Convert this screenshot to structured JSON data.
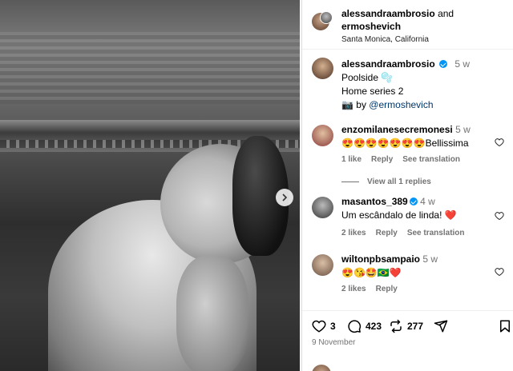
{
  "header": {
    "user1": "alessandraambrosio",
    "and_text": "and",
    "user2": "ermoshevich",
    "location": "Santa Monica, California"
  },
  "caption": {
    "username": "alessandraambrosio",
    "time": "5 w",
    "line1": "Poolside 🫧",
    "line2": "Home series 2",
    "photo_prefix": "📷 by ",
    "photo_credit": "@ermoshevich"
  },
  "comments": [
    {
      "username": "enzomilanesecremonesi",
      "time": "5 w",
      "text": "😍😍😍😍😍😍😍Bellissima",
      "likes": "1 like",
      "reply": "Reply",
      "translate": "See translation",
      "verified": false
    },
    {
      "username": "masantos_389",
      "time": "4 w",
      "text": "Um escândalo de linda! ❤️",
      "likes": "2 likes",
      "reply": "Reply",
      "translate": "See translation",
      "verified": true
    },
    {
      "username": "wiltonpbsampaio",
      "time": "5 w",
      "text": "😍😘🤩🇧🇷❤️",
      "likes": "2 likes",
      "reply": "Reply",
      "translate": "",
      "verified": false
    }
  ],
  "view_replies": "View all 1 replies",
  "actions": {
    "likes_count": "3",
    "comments_count": "423",
    "reposts_count": "277"
  },
  "date": "9 November",
  "colors": {
    "verified": "#0095f6",
    "link": "#00376b",
    "muted": "#737373"
  }
}
